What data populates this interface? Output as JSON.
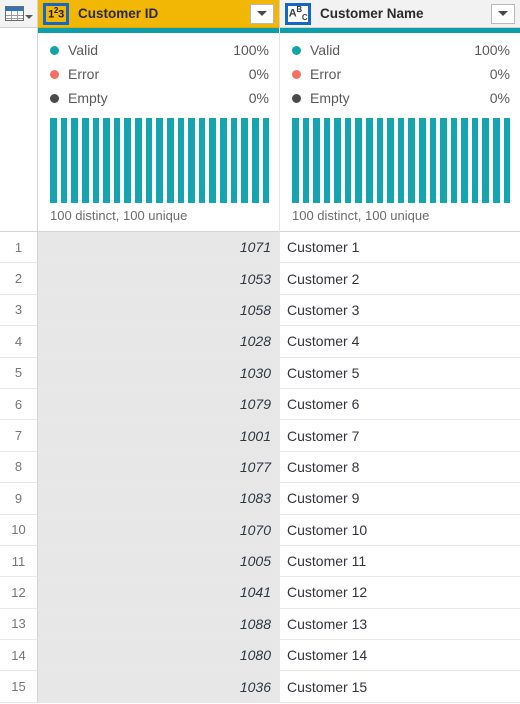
{
  "grid": {
    "corner_icon": "table-icon",
    "corner_dropdown_icon": "chevron-down-icon"
  },
  "columns": [
    {
      "id": "customer_id",
      "title": "Customer ID",
      "type_icon": "numeric-type-icon",
      "type_badge": "1²3",
      "selected": true,
      "dropdown_icon": "chevron-down-icon",
      "quality": {
        "items": [
          {
            "label": "Valid",
            "value": "100%",
            "color": "#12a5a5"
          },
          {
            "label": "Error",
            "value": "0%",
            "color": "#f4715f"
          },
          {
            "label": "Empty",
            "value": "0%",
            "color": "#4a4a4a"
          }
        ],
        "distinct_note": "100 distinct, 100 unique"
      }
    },
    {
      "id": "customer_name",
      "title": "Customer Name",
      "type_icon": "text-type-icon",
      "type_badge": "ABC",
      "selected": false,
      "dropdown_icon": "chevron-down-icon",
      "quality": {
        "items": [
          {
            "label": "Valid",
            "value": "100%",
            "color": "#12a5a5"
          },
          {
            "label": "Error",
            "value": "0%",
            "color": "#f4715f"
          },
          {
            "label": "Empty",
            "value": "0%",
            "color": "#4a4a4a"
          }
        ],
        "distinct_note": "100 distinct, 100 unique"
      }
    }
  ],
  "histogram": {
    "bar_count": 21,
    "bar_color": "#14a5b0",
    "uniform_height": true
  },
  "colors": {
    "selected_header": "#f2b705",
    "quality_bar": "#0d9dab",
    "selection_outline": "#1268c3",
    "selected_column_cell": "#e7e7e7"
  },
  "rows": [
    {
      "num": "1",
      "customer_id": "1071",
      "customer_name": "Customer 1"
    },
    {
      "num": "2",
      "customer_id": "1053",
      "customer_name": "Customer 2"
    },
    {
      "num": "3",
      "customer_id": "1058",
      "customer_name": "Customer 3"
    },
    {
      "num": "4",
      "customer_id": "1028",
      "customer_name": "Customer 4"
    },
    {
      "num": "5",
      "customer_id": "1030",
      "customer_name": "Customer 5"
    },
    {
      "num": "6",
      "customer_id": "1079",
      "customer_name": "Customer 6"
    },
    {
      "num": "7",
      "customer_id": "1001",
      "customer_name": "Customer 7"
    },
    {
      "num": "8",
      "customer_id": "1077",
      "customer_name": "Customer 8"
    },
    {
      "num": "9",
      "customer_id": "1083",
      "customer_name": "Customer 9"
    },
    {
      "num": "10",
      "customer_id": "1070",
      "customer_name": "Customer 10"
    },
    {
      "num": "11",
      "customer_id": "1005",
      "customer_name": "Customer 11"
    },
    {
      "num": "12",
      "customer_id": "1041",
      "customer_name": "Customer 12"
    },
    {
      "num": "13",
      "customer_id": "1088",
      "customer_name": "Customer 13"
    },
    {
      "num": "14",
      "customer_id": "1080",
      "customer_name": "Customer 14"
    },
    {
      "num": "15",
      "customer_id": "1036",
      "customer_name": "Customer 15"
    }
  ]
}
